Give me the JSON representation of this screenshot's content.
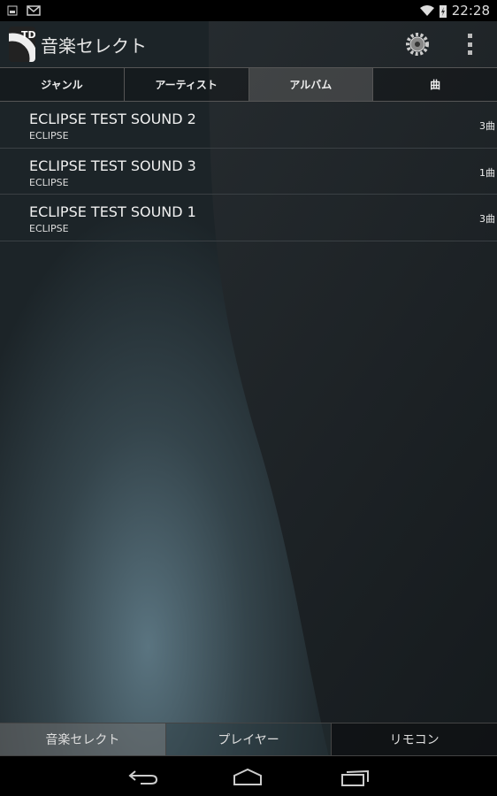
{
  "status_bar": {
    "time": "22:28",
    "icons": [
      "image-icon",
      "gmail-icon",
      "wifi-icon",
      "battery-charging-icon"
    ]
  },
  "action_bar": {
    "title": "音楽セレクト",
    "icons": [
      "app-logo",
      "settings-gear-icon",
      "overflow-menu-icon"
    ]
  },
  "tabs": [
    {
      "label": "ジャンル"
    },
    {
      "label": "アーティスト"
    },
    {
      "label": "アルバム",
      "active": true
    },
    {
      "label": "曲"
    }
  ],
  "albums": [
    {
      "name": "ECLIPSE TEST SOUND 2",
      "artist": "ECLIPSE",
      "count": "3曲"
    },
    {
      "name": "ECLIPSE TEST SOUND 3",
      "artist": "ECLIPSE",
      "count": "1曲"
    },
    {
      "name": "ECLIPSE TEST SOUND 1",
      "artist": "ECLIPSE",
      "count": "3曲"
    }
  ],
  "bottom_tabs": [
    {
      "label": "音楽セレクト",
      "active": true
    },
    {
      "label": "プレイヤー"
    },
    {
      "label": "リモコン"
    }
  ],
  "nav_bar": {
    "icons": [
      "back-icon",
      "home-icon",
      "recents-icon"
    ]
  }
}
